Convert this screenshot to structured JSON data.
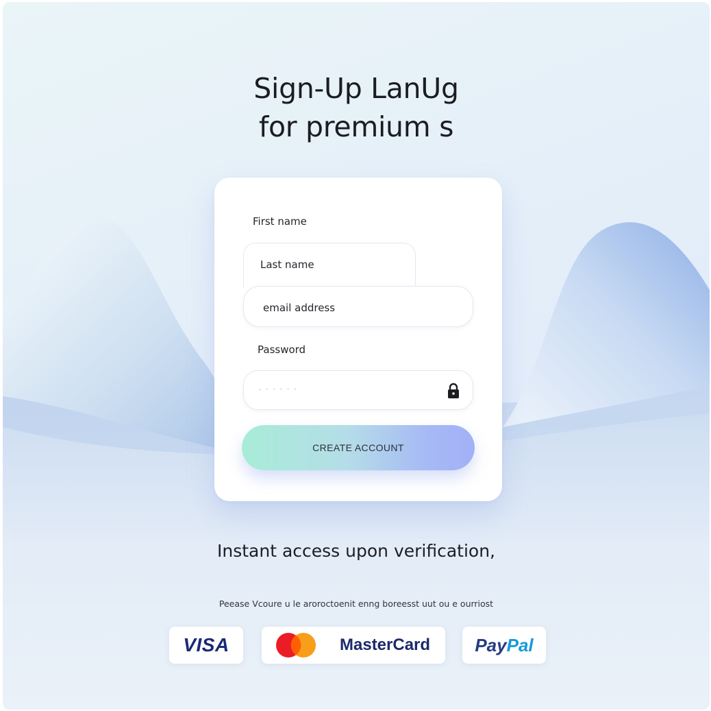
{
  "header": {
    "title_line1": "Sign-Up LanUg",
    "title_line2": "for premium s"
  },
  "form": {
    "first_name_label": "First name",
    "last_name_placeholder": "Last name",
    "email_placeholder": "email address",
    "password_label": "Password",
    "password_mask": "-·····",
    "lock_icon": "lock-icon",
    "submit_label": "CREATE ACCOUNT"
  },
  "footer": {
    "tagline": "Instant access upon verification,",
    "note": "Peease Vcoure u le aroroctoenit enng boreesst uut ou e ourriost"
  },
  "payments": {
    "visa": "VISA",
    "mastercard": "MasterCard",
    "paypal_part1": "Pay",
    "paypal_part2": "Pal"
  },
  "colors": {
    "button_gradient_start": "#a8ecd7",
    "button_gradient_end": "#a2b1f6",
    "visa_blue": "#1a2a73",
    "mastercard_red": "#eb1c26",
    "mastercard_orange": "#f79e1b",
    "paypal_dark": "#253b80",
    "paypal_light": "#179bd7"
  }
}
